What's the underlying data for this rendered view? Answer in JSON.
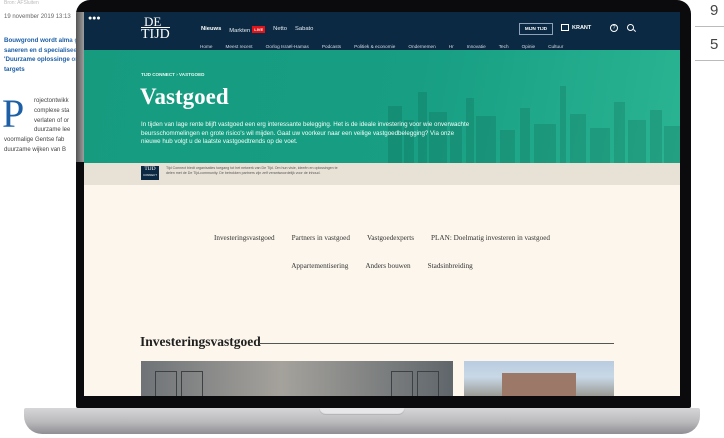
{
  "background_article": {
    "top_faded": "Bron: AFSluiten",
    "date": "19 november 2019  13:13",
    "headline": "Bouwgrond wordt alma gebieden saneren en d specialiseerde, heeft z 'Duurzame oplossinge onze financiële targets",
    "dropcap": "P",
    "body_lines": [
      "rojectontwikk",
      "complexe sta",
      "verlaten of or",
      "duurzame lee",
      "voormalige Gentse fab",
      "duurzame wijken van B"
    ]
  },
  "background_right": {
    "numbers": [
      "9",
      "5"
    ]
  },
  "browser": {
    "dots": "● ● ●"
  },
  "header": {
    "logo_top": "DE",
    "logo_bottom": "TIJD",
    "nav": [
      "Nieuws",
      "Markten",
      "Netto",
      "Sabato"
    ],
    "live_badge": "LIVE",
    "subnav": [
      "Home",
      "Meest recent",
      "Oorlog Israël-Hamas",
      "Podcasts",
      "Politiek & economie",
      "Ondernemen",
      "Hr",
      "Innovatie",
      "Tech",
      "Opinie",
      "Cultuur"
    ],
    "mijn_tijd": "MIJN TIJD",
    "krant": "KRANT",
    "help_glyph": "?",
    "icons": [
      "krant-icon",
      "help-icon",
      "search-icon"
    ]
  },
  "hero": {
    "breadcrumb": "TIJD CONNECT  ›  VASTGOED",
    "title": "Vastgoed",
    "description": "In tijden van lage rente blijft vastgoed een erg interessante belegging. Het is de ideale investering voor wie onverwachte beursschommelingen en grote risico's wil mijden. Gaat uw voorkeur naar een veilige vastgoedbelegging? Via onze nieuwe hub volgt u de laatste vastgoedtrends op de voet."
  },
  "connect_strip": {
    "logo_top": "TIJD",
    "logo_bottom": "CONNECT",
    "text": "Tijd Connect biedt organisaties toegang tot het netwerk van De Tijd. Om hun visie, ideeën en oplossingen te delen met de De Tijd-community. De betrokken partners zijn zelf verantwoordelijk voor de inhoud."
  },
  "topics_row1": [
    "Investeringsvastgoed",
    "Partners in vastgoed",
    "Vastgoedexperts",
    "PLAN: Doelmatig investeren in vastgoed"
  ],
  "topics_row2": [
    "Appartementisering",
    "Anders bouwen",
    "Stadsinbreiding"
  ],
  "section": {
    "title": "Investeringsvastgoed"
  },
  "colors": {
    "header": "#0b2942",
    "hero": "#169b7f",
    "strip": "#e8e1d6",
    "page": "#fcf6ec",
    "live": "#e0141b",
    "link_blue": "#1d5fa6"
  }
}
